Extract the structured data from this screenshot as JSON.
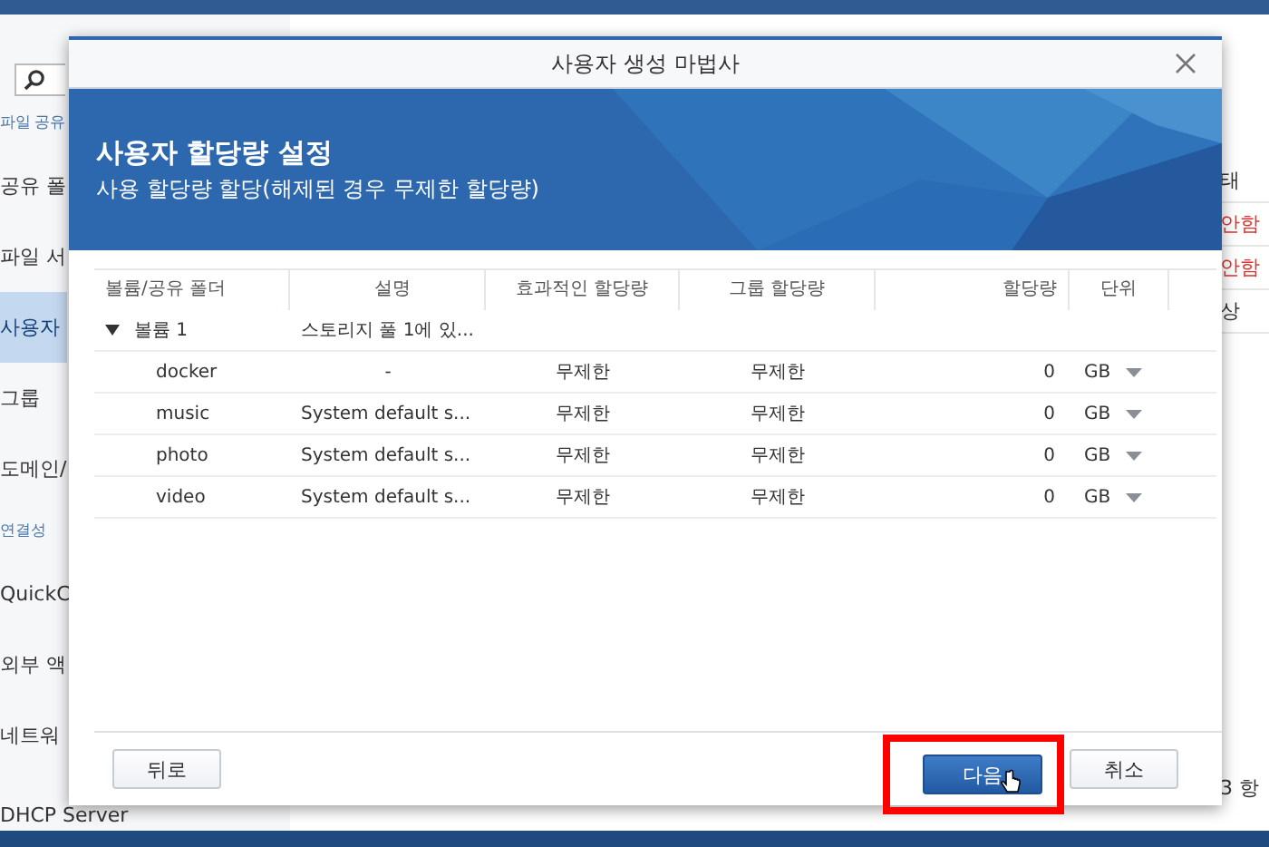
{
  "sidebar": {
    "items": [
      {
        "label": "파일 공유",
        "kind": "section"
      },
      {
        "label": "공유 폴",
        "kind": "item",
        "selected": false
      },
      {
        "label": "파일 서",
        "kind": "item",
        "selected": false
      },
      {
        "label": "사용자",
        "kind": "item",
        "selected": true
      },
      {
        "label": "그룹",
        "kind": "item",
        "selected": false
      },
      {
        "label": "도메인/",
        "kind": "item",
        "selected": false
      },
      {
        "label": "연결성",
        "kind": "section"
      },
      {
        "label": "QuickC",
        "kind": "item",
        "selected": false
      },
      {
        "label": "외부 액",
        "kind": "item",
        "selected": false
      },
      {
        "label": "네트워",
        "kind": "item",
        "selected": false
      },
      {
        "label": "DHCP Server",
        "kind": "item",
        "selected": false
      }
    ]
  },
  "right_list": {
    "cells": [
      {
        "text": "태",
        "kind": "header"
      },
      {
        "text": "안함",
        "kind": "warning"
      },
      {
        "text": "안함",
        "kind": "warning"
      },
      {
        "text": "상",
        "kind": "normal"
      }
    ],
    "count": "3 항"
  },
  "dialog": {
    "title": "사용자 생성 마법사",
    "banner_title": "사용자 할당량 설정",
    "banner_subtitle": "사용 할당량 할당(해제된 경우 무제한 할당량)",
    "columns": [
      "볼륨/공유 폴더",
      "설명",
      "효과적인 할당량",
      "그룹 할당량",
      "할당량",
      "단위"
    ],
    "volumes": [
      {
        "name": "볼륨 1",
        "description": "스토리지 풀 1에 있...",
        "expanded": true,
        "children": [
          {
            "folder": "docker",
            "description": "-",
            "effective": "무제한",
            "group": "무제한",
            "quota": "0",
            "unit": "GB"
          },
          {
            "folder": "music",
            "description": "System default s...",
            "effective": "무제한",
            "group": "무제한",
            "quota": "0",
            "unit": "GB"
          },
          {
            "folder": "photo",
            "description": "System default s...",
            "effective": "무제한",
            "group": "무제한",
            "quota": "0",
            "unit": "GB"
          },
          {
            "folder": "video",
            "description": "System default s...",
            "effective": "무제한",
            "group": "무제한",
            "quota": "0",
            "unit": "GB"
          }
        ]
      }
    ],
    "buttons": [
      {
        "label": "뒤로",
        "kind": "secondary"
      },
      {
        "label": "다음",
        "kind": "primary",
        "highlighted": true
      },
      {
        "label": "취소",
        "kind": "secondary"
      }
    ]
  }
}
